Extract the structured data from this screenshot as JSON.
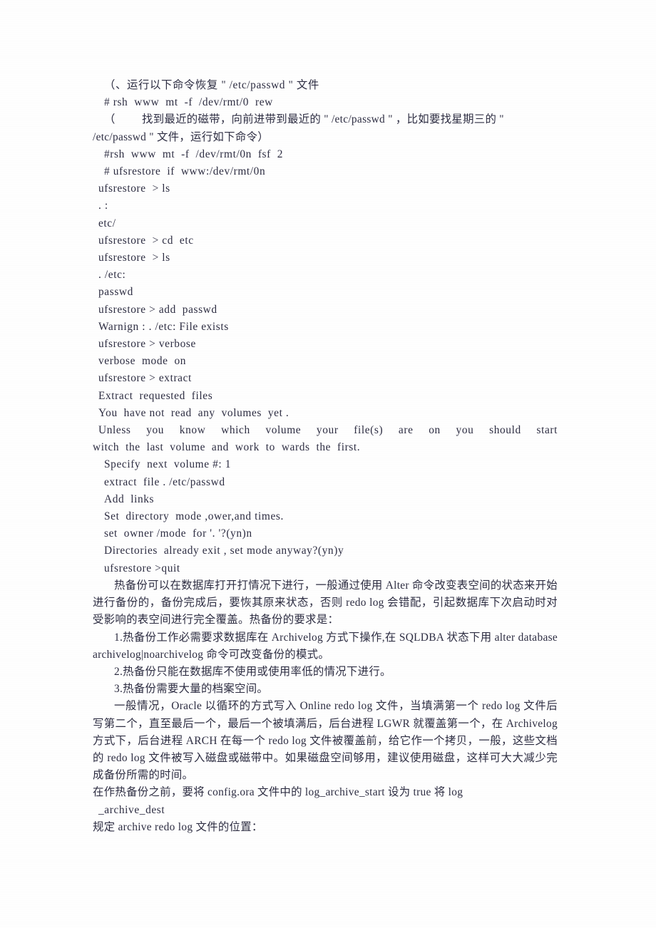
{
  "document": {
    "type": "scanned-technical-document",
    "language": "zh-CN,en",
    "text_color": "#2d2d42",
    "background_color": "#fefefe"
  },
  "lines": [
    {
      "id": "l01",
      "indent": 2,
      "style": "cn",
      "text": "（、运行以下命令恢复 \" /etc/passwd \" 文件"
    },
    {
      "id": "l02",
      "indent": 2,
      "style": "mono",
      "text": "# rsh  www  mt  -f  /dev/rmt/0  rew"
    },
    {
      "id": "l03",
      "indent": 2,
      "style": "cn",
      "text": "（         找到最近的磁带，向前进带到最近的 \" /etc/passwd \" ，比如要找星期三的 \""
    },
    {
      "id": "l04",
      "indent": 0,
      "style": "cn",
      "text": "/etc/passwd \" 文件，运行如下命令）"
    },
    {
      "id": "l05",
      "indent": 2,
      "style": "mono",
      "text": "#rsh  www  mt  -f  /dev/rmt/0n  fsf  2"
    },
    {
      "id": "l06",
      "indent": 2,
      "style": "mono",
      "text": "# ufsrestore  if  www:/dev/rmt/0n"
    },
    {
      "id": "l07",
      "indent": 1,
      "style": "mono",
      "text": "ufsrestore  > ls"
    },
    {
      "id": "l08",
      "indent": 1,
      "style": "mono",
      "text": ". :"
    },
    {
      "id": "l09",
      "indent": 1,
      "style": "mono",
      "text": "etc/"
    },
    {
      "id": "l10",
      "indent": 1,
      "style": "mono",
      "text": "ufsrestore  > cd  etc"
    },
    {
      "id": "l11",
      "indent": 1,
      "style": "mono",
      "text": "ufsrestore  > ls"
    },
    {
      "id": "l12",
      "indent": 1,
      "style": "mono",
      "text": ". /etc:"
    },
    {
      "id": "l13",
      "indent": 1,
      "style": "mono",
      "text": "passwd"
    },
    {
      "id": "l14",
      "indent": 1,
      "style": "mono",
      "text": "ufsrestore > add  passwd"
    },
    {
      "id": "l15",
      "indent": 1,
      "style": "mono",
      "text": "Warnign : . /etc: File exists"
    },
    {
      "id": "l16",
      "indent": 1,
      "style": "mono",
      "text": "ufsrestore > verbose"
    },
    {
      "id": "l17",
      "indent": 1,
      "style": "mono",
      "text": "verbose  mode  on"
    },
    {
      "id": "l18",
      "indent": 1,
      "style": "mono",
      "text": "ufsrestore > extract"
    },
    {
      "id": "l19",
      "indent": 1,
      "style": "mono",
      "text": "Extract  requested  files"
    },
    {
      "id": "l20",
      "indent": 1,
      "style": "mono",
      "text": "You  have not  read  any  volumes  yet ."
    },
    {
      "id": "l22",
      "indent": 0,
      "style": "mono",
      "text": "witch  the  last  volume  and  work  to  wards  the  first."
    },
    {
      "id": "l23",
      "indent": 2,
      "style": "mono",
      "text": "Specify  next  volume #: 1"
    },
    {
      "id": "l24",
      "indent": 2,
      "style": "mono",
      "text": "extract  file . /etc/passwd"
    },
    {
      "id": "l25",
      "indent": 2,
      "style": "mono",
      "text": "Add  links"
    },
    {
      "id": "l26",
      "indent": 2,
      "style": "mono",
      "text": "Set  directory  mode ,ower,and times."
    },
    {
      "id": "l27",
      "indent": 2,
      "style": "mono",
      "text": "set  owner /mode  for '. '?(yn)n"
    },
    {
      "id": "l28",
      "indent": 2,
      "style": "mono",
      "text": "Directories  already exit , set mode anyway?(yn)y"
    },
    {
      "id": "l29",
      "indent": 2,
      "style": "mono",
      "text": "ufsrestore >quit"
    }
  ],
  "justified_line": {
    "id": "l21",
    "text": "Unless  you  know  which  volume  your  file(s)  are  on  you  should  start"
  },
  "paragraphs": {
    "hot_backup_intro": "热备份可以在数据库打开打情况下进行，一般通过使用 Alter 命令改变表空间的状态来开始进行备份的，备份完成后，要恢其原来状态，否则 redo log 会错配，引起数据库下次启动时对受影响的表空间进行完全覆盖。热备份的要求是：",
    "requirement_1": "1.热备份工作必需要求数据库在 Archivelog 方式下操作,在 SQLDBA 状态下用 alter database archivelog|noarchivelog 命令可改变备份的模式。",
    "requirement_2": "2.热备份只能在数据库不使用或使用率低的情况下进行。",
    "requirement_3": "3.热备份需要大量的档案空间。",
    "redo_log_explain": "一般情况，Oracle 以循环的方式写入 Online redo log 文件，当填满第一个 redo log 文件后写第二个，直至最后一个，最后一个被填满后，后台进程 LGWR 就覆盖第一个，在 Archivelog 方式下，后台进程 ARCH 在每一个 redo log 文件被覆盖前，给它作一个拷贝，一般，这些文档的 redo log 文件被写入磁盘或磁带中。如果磁盘空间够用，建议使用磁盘，这样可大大减少完成备份所需的时间。",
    "config_ora_line": "在作热备份之前，要将 config.ora 文件中的 log_archive_start 设为 true 将 log",
    "config_ora_cont": "_archive_dest",
    "archive_location_line": "规定 archive redo log 文件的位置："
  }
}
